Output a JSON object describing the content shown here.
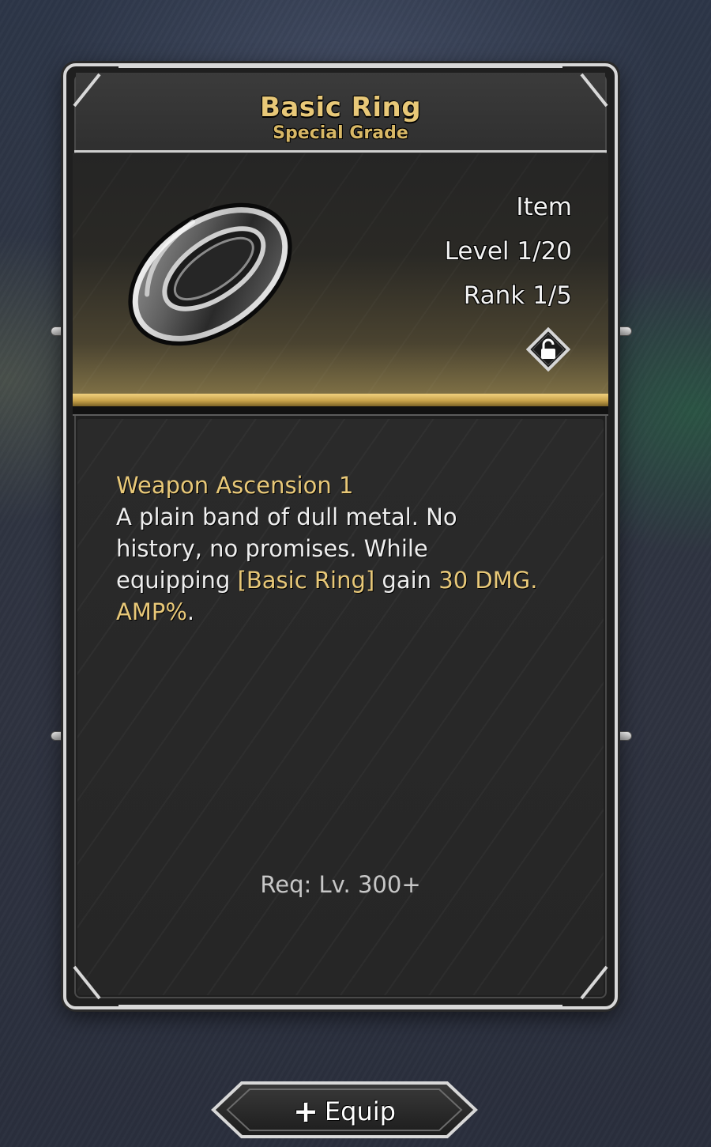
{
  "item": {
    "name": "Basic Ring",
    "grade": "Special Grade",
    "type": "Item",
    "level": "Level 1/20",
    "rank": "Rank 1/5",
    "lock_icon": "unlocked-padlock-icon",
    "image_icon": "silver-ring-icon"
  },
  "description": {
    "title": "Weapon Ascension 1",
    "text_1": "A plain band of dull metal. No history, no promises. While equipping ",
    "highlight_item": "[Basic Ring]",
    "text_2": " gain ",
    "highlight_value": "30 DMG. AMP%",
    "text_3": "."
  },
  "requirement": "Req: Lv. 300+",
  "actions": {
    "equip_label": "Equip",
    "equip_icon": "plus-icon"
  },
  "colors": {
    "gold": "#e8c878",
    "frame": "#d8d8d8",
    "card_bg": "#262626"
  }
}
